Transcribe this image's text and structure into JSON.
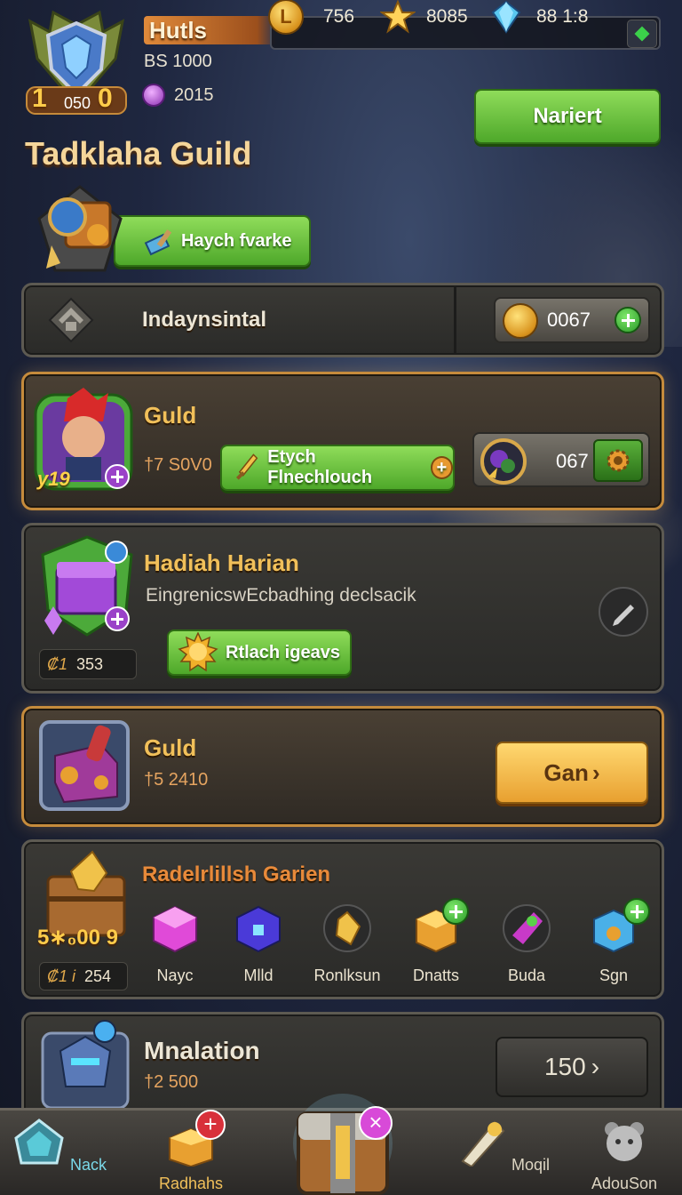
{
  "player": {
    "name": "Hutls",
    "sub": "BS 1000",
    "gems": "2015",
    "emblem_level_left": "1",
    "emblem_level_mid": "050",
    "emblem_level_right": "0"
  },
  "resources": [
    {
      "icon": "coin-icon",
      "value": "756"
    },
    {
      "icon": "star-icon",
      "value": "8085"
    },
    {
      "icon": "crystal-icon",
      "value": "88 1:8"
    }
  ],
  "top_button": "Nariert",
  "guild": {
    "title": "Tadklaha Guild",
    "badge_button": "Haych fvarke"
  },
  "panel_indaynsintal": {
    "title": "Indaynsintal",
    "counter": "0067"
  },
  "panel_guild1": {
    "title": "Guld",
    "sub": "†7 S0V0",
    "level": "19",
    "button": "Etych Flnechlouch",
    "counter": "067"
  },
  "panel_hadiah": {
    "title": "Hadiah Harian",
    "desc": "EingrenicswEcbadhing declsacik",
    "button": "Rtlach igeavs",
    "counter_icon": "₡1",
    "counter": "353"
  },
  "panel_guild2": {
    "title": "Guld",
    "sub": "†5 2410",
    "button": "Gan"
  },
  "panel_rewards": {
    "title": "Radelrlillsh Garien",
    "chest_badge": "5∗₀00 9",
    "counter_icon": "₡1 i",
    "counter": "254",
    "items": [
      {
        "label": "Nayc"
      },
      {
        "label": "Mlld"
      },
      {
        "label": "Ronlksun"
      },
      {
        "label": "Dnatts"
      },
      {
        "label": "Buda"
      },
      {
        "label": "Sgn"
      }
    ]
  },
  "panel_mnalation": {
    "title": "Mnalation",
    "sub": "†2 500",
    "button": "150"
  },
  "nav": [
    {
      "label": "Nack"
    },
    {
      "label": "Radhahs"
    },
    {
      "label": "Moqil"
    },
    {
      "label": "AdouSon"
    }
  ],
  "colors": {
    "accent_gold": "#f1c05a",
    "green_button": "#4ea82a",
    "panel_bg": "#2a2a28"
  }
}
